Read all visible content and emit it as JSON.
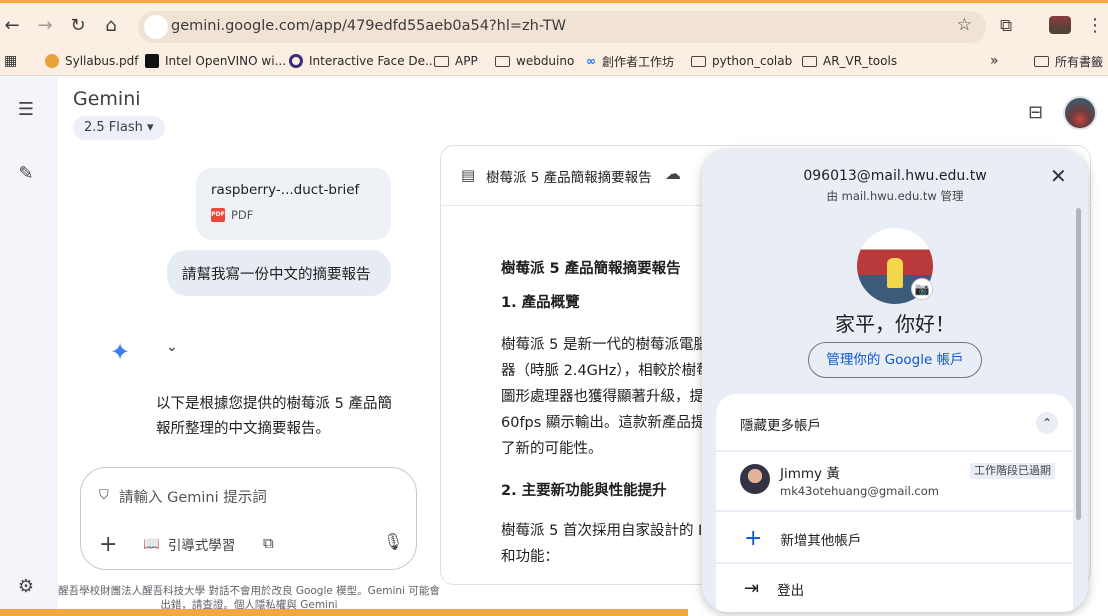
{
  "browser": {
    "url": "gemini.google.com/app/479edfd55aeb0a54?hl=zh-TW",
    "bookmarks": [
      "Syllabus.pdf",
      "Intel OpenVINO wi...",
      "Interactive Face De...",
      "APP",
      "webduino",
      "創作者工作坊",
      "python_colab",
      "AR_VR_tools"
    ],
    "more": "»",
    "all_bookmarks": "所有書籤"
  },
  "app": {
    "title": "Gemini",
    "model": "2.5 Flash"
  },
  "chat": {
    "file_name": "raspberry-...duct-brief",
    "file_type": "PDF",
    "user_message": "請幫我寫一份中文的摘要報告",
    "reply": "以下是根據您提供的樹莓派 5 產品簡報所整理的中文摘要報告。",
    "input_placeholder": "請輸入 Gemini 提示詞",
    "guided_label": "引導式學習",
    "disclaimer": "醒吾學校財團法人醒吾科技大學 對話不會用於改良 Google 模型。Gemini 可能會出錯，請查證。個人隱私權與 Gemini"
  },
  "doc": {
    "header_title": "樹莓派 5 產品簡報摘要報告",
    "title": "樹莓派 5 產品簡報摘要報告",
    "section1": "1. 產品概覽",
    "para1": "樹莓派 5 是新一代的樹莓派電腦",
    "para1b": "器（時脈 2.4GHz），相較於樹莓",
    "para1c": "圖形處理器也獲得顯著升級，提",
    "para1d": "60fps 顯示輸出。這款新產品提",
    "para1e": "了新的可能性。",
    "section2": "2. 主要新功能與性能提升",
    "para2": "樹莓派 5 首次採用自家設計的 I",
    "para2b": "和功能："
  },
  "account": {
    "email": "096013@mail.hwu.edu.tw",
    "managed_by": "由 mail.hwu.edu.tw 管理",
    "greeting": "家平，你好！",
    "manage_button": "管理你的 Google 帳戶",
    "hide_more": "隱藏更多帳戶",
    "other_name": "Jimmy 黃",
    "other_email": "mk43otehuang@gmail.com",
    "expired": "工作階段已過期",
    "add_account": "新增其他帳戶",
    "logout": "登出"
  }
}
